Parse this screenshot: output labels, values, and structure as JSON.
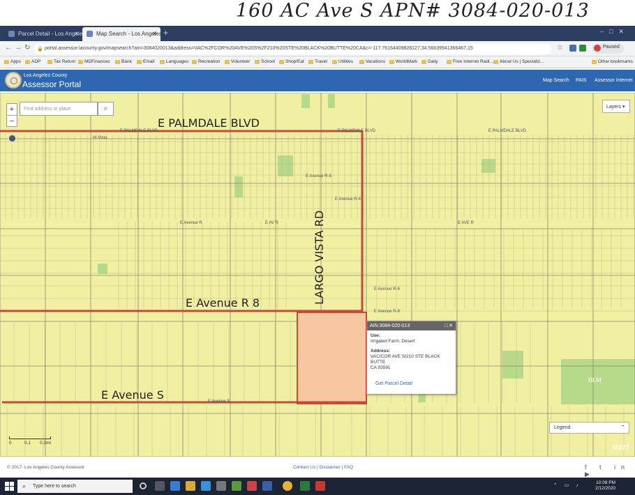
{
  "note": {
    "handwritten_title": "160 AC Ave S  APN# 3084-020-013"
  },
  "browser": {
    "tabs": [
      {
        "label": "Parcel Detail - Los Angeles Coun"
      },
      {
        "label": "Map Search - Los Angeles Coun"
      }
    ],
    "url": "portal.assessor.lacounty.gov/mapsearch?ain=3084020013&address=VAC%2FCOR%20AVE%20S%2F210%20STE%20BLACK%20BUTTE%20CA&c=-117.76164409828127,34.56839941366467,15",
    "profile_status": "Paused",
    "bookmarks": [
      "Apps",
      "ADP",
      "Tax Return",
      "MDFinances",
      "Bank",
      "Email",
      "Languages",
      "Recreation",
      "Volunteer",
      "School",
      "Shop/Eat",
      "Travel",
      "Utilities",
      "Vacations",
      "WorldMark",
      "Daily",
      "Free Internet Radi...",
      "About Us | Specializ...",
      "Other bookmarks"
    ]
  },
  "portal": {
    "subtitle": "Los Angeles County",
    "title": "Assessor Portal",
    "nav": [
      "Map Search",
      "PAIS",
      "Assessor Internet"
    ]
  },
  "map": {
    "search_placeholder": "Find address or place",
    "layers_label": "Layers",
    "zoom_in": "+",
    "zoom_out": "−",
    "handwritten_labels": {
      "palmdale": "E PALMDALE BLVD",
      "largo": "LARGO VISTA RD",
      "avenue_r8": "E Avenue R 8",
      "avenue_s": "E Avenue S"
    },
    "street_labels": {
      "palmdale_left": "E PALMDALE BLVD",
      "palmdale_right": "E PALMDALE BLVD",
      "palmdale_mid": "E PALMDALE BLVD",
      "hi_vista": "Hi Vista",
      "avenue_r8_mid": "E Avenue R-8",
      "avenue_r4": "E Avenue R-4",
      "avenue_r_left": "E Avenue R",
      "avenue_r_mid": "E AV R",
      "avenue_r_right": "E AVE R",
      "avenue_s_map": "E Avenue S",
      "avenue_r6": "E Avenue R-6",
      "avenue_r8_right": "E Avenue R-8",
      "blm": "BLM"
    },
    "legend_label": "Legend",
    "scale_labels": [
      "0",
      "0.1",
      "0.2mi"
    ],
    "attribution": "esri"
  },
  "popup": {
    "ain": "AIN:3084-020-013",
    "use_label": "Use:",
    "use_value": "Irrigated Farm, Desert",
    "address_label": "Address:",
    "address_line1": "VAC/COR AVE S/210 STE BLACK BUTTE",
    "address_line2": "CA 93591",
    "link": "Get Parcel Detail"
  },
  "footer": {
    "copyright": "© 2017- Los Angeles County Assessor",
    "links": "Contact Us | Disclaimer | FAQ",
    "social": "f t in ▶"
  },
  "taskbar": {
    "search_placeholder": "Type here to search",
    "time": "10:08 PM",
    "date": "2/12/2020"
  },
  "colors": {
    "map_bg": "#f0efa2",
    "parcel_line": "#7d7a5a",
    "highlight_road": "#c8483a",
    "parcel_fill": "#f6c7a0",
    "green_area": "#b7d98a",
    "portal_blue": "#2e67b1"
  }
}
